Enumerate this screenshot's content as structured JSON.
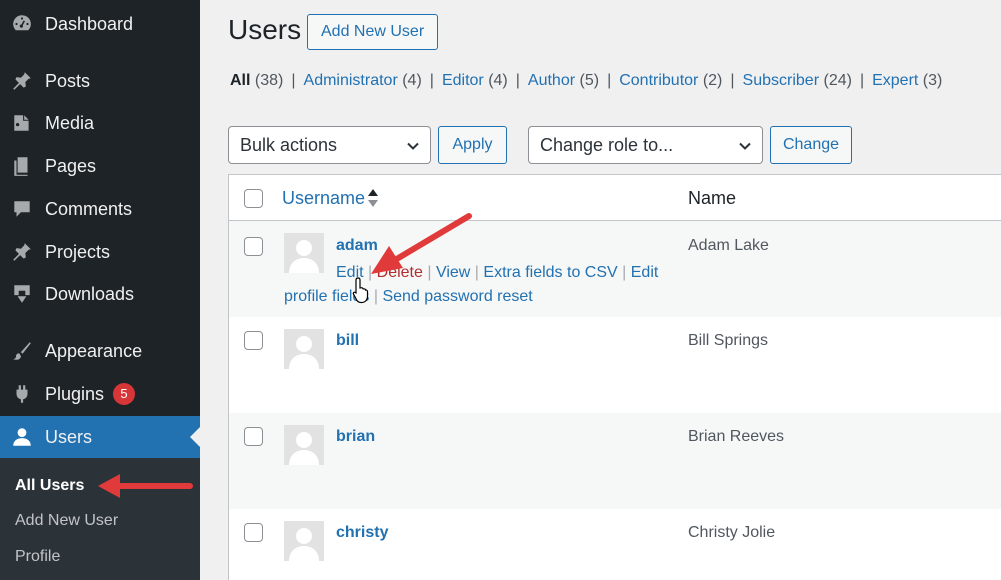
{
  "colors": {
    "accent": "#2271b1",
    "sidebar_bg": "#1d2327",
    "arrow": "#e03a3a",
    "badge": "#d63638"
  },
  "sidebar": {
    "items": [
      {
        "label": "Dashboard",
        "icon": "dashboard-icon"
      },
      {
        "label": "Posts",
        "icon": "pin-icon"
      },
      {
        "label": "Media",
        "icon": "media-icon"
      },
      {
        "label": "Pages",
        "icon": "pages-icon"
      },
      {
        "label": "Comments",
        "icon": "comment-icon"
      },
      {
        "label": "Projects",
        "icon": "pin-icon"
      },
      {
        "label": "Downloads",
        "icon": "download-icon"
      },
      {
        "label": "Appearance",
        "icon": "brush-icon"
      },
      {
        "label": "Plugins",
        "icon": "plug-icon",
        "badge": "5"
      },
      {
        "label": "Users",
        "icon": "user-icon",
        "active": true
      }
    ],
    "submenu": [
      "All Users",
      "Add New User",
      "Profile"
    ]
  },
  "header": {
    "title": "Users",
    "add_new": "Add New User"
  },
  "filters": [
    {
      "label": "All",
      "count": "(38)"
    },
    {
      "label": "Administrator",
      "count": "(4)"
    },
    {
      "label": "Editor",
      "count": "(4)"
    },
    {
      "label": "Author",
      "count": "(5)"
    },
    {
      "label": "Contributor",
      "count": "(2)"
    },
    {
      "label": "Subscriber",
      "count": "(24)"
    },
    {
      "label": "Expert",
      "count": "(3)"
    }
  ],
  "toolbar": {
    "bulk_actions": "Bulk actions",
    "apply": "Apply",
    "change_role": "Change role to...",
    "change": "Change"
  },
  "table": {
    "col_username": "Username",
    "col_name": "Name",
    "rows": [
      {
        "username": "adam",
        "name": "Adam Lake"
      },
      {
        "username": "bill",
        "name": "Bill Springs"
      },
      {
        "username": "brian",
        "name": "Brian Reeves"
      },
      {
        "username": "christy",
        "name": "Christy Jolie"
      }
    ],
    "row_actions": {
      "edit": "Edit",
      "delete": "Delete",
      "view": "View",
      "extra_fields": "Extra fields to CSV",
      "edit_profile_fields": "Edit profile fields",
      "send_reset": "Send password reset",
      "sep": "|"
    }
  }
}
